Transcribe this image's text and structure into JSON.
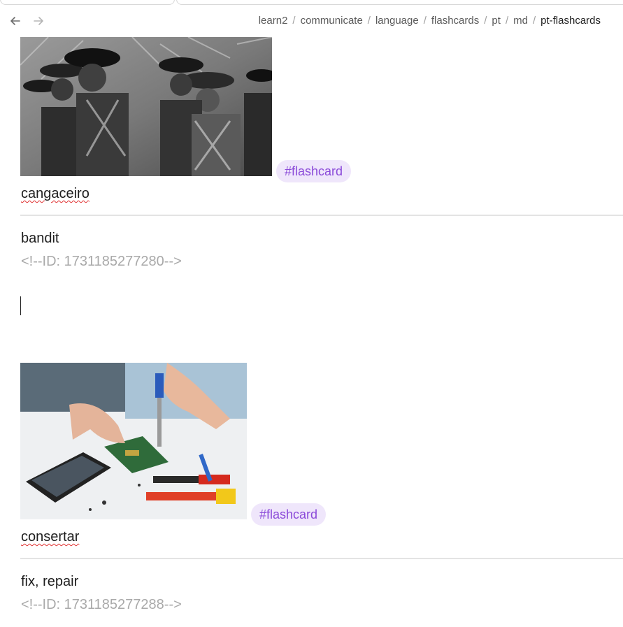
{
  "nav": {
    "back_icon": "arrow-left-icon",
    "forward_icon": "arrow-right-icon"
  },
  "breadcrumb": [
    "learn2",
    "communicate",
    "language",
    "flashcards",
    "pt",
    "md",
    "pt-flashcards"
  ],
  "cards": [
    {
      "tag": "#flashcard",
      "front": "cangaceiro",
      "back": "bandit",
      "id_comment": "<!--ID: 1731185277280-->"
    },
    {
      "tag": "#flashcard",
      "front": "consertar",
      "back": "fix, repair",
      "id_comment": "<!--ID: 1731185277288-->"
    }
  ],
  "colors": {
    "tag_bg": "#efe6fb",
    "tag_text": "#8b4ad9",
    "comment": "#a9a9a9"
  }
}
